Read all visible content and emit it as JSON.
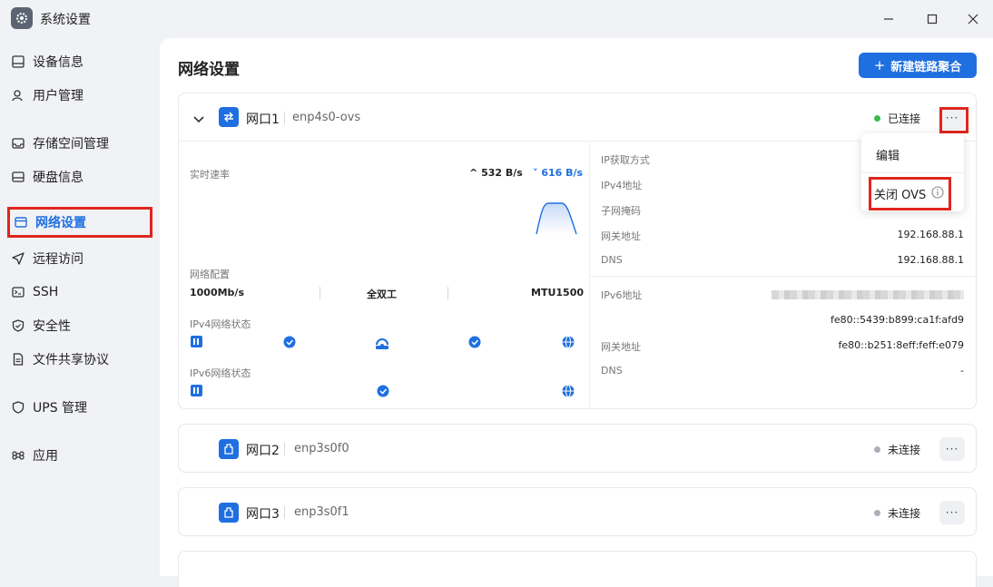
{
  "window": {
    "title": "系统设置"
  },
  "sidebar": {
    "items": [
      {
        "label": "设备信息",
        "icon": "device-icon"
      },
      {
        "label": "用户管理",
        "icon": "user-icon"
      },
      {
        "label": "存储空间管理",
        "icon": "storage-icon"
      },
      {
        "label": "硬盘信息",
        "icon": "disk-icon"
      },
      {
        "label": "网络设置",
        "icon": "network-icon",
        "active": true
      },
      {
        "label": "远程访问",
        "icon": "send-icon"
      },
      {
        "label": "SSH",
        "icon": "terminal-icon"
      },
      {
        "label": "安全性",
        "icon": "shield-icon"
      },
      {
        "label": "文件共享协议",
        "icon": "file-icon"
      },
      {
        "label": "UPS 管理",
        "icon": "ups-shield-icon"
      },
      {
        "label": "应用",
        "icon": "command-icon"
      }
    ]
  },
  "main": {
    "title": "网络设置",
    "new_button": "新建链路聚合",
    "ports": [
      {
        "name": "网口1",
        "device": "enp4s0-ovs",
        "status": "已连接",
        "status_color": "#3fb950",
        "left": {
          "speed_label": "实时速率",
          "up_speed": "532 B/s",
          "down_speed": "616 B/s",
          "config_label": "网络配置",
          "link_speed": "1000Mb/s",
          "duplex": "全双工",
          "mtu": "MTU1500",
          "ipv4_status_label": "IPv4网络状态",
          "ipv6_status_label": "IPv6网络状态"
        },
        "right": {
          "ip_method_label": "IP获取方式",
          "ipv4_label": "IPv4地址",
          "mask_label": "子网掩码",
          "gateway_label": "网关地址",
          "gateway": "192.168.88.1",
          "dns_label": "DNS",
          "dns": "192.168.88.1",
          "ipv6_label": "IPv6地址",
          "ipv6": "fe80::5439:b899:ca1f:afd9",
          "gateway6_label": "网关地址",
          "gateway6": "fe80::b251:8eff:feff:e079",
          "dns6_label": "DNS",
          "dns6": "-"
        }
      },
      {
        "name": "网口2",
        "device": "enp3s0f0",
        "status": "未连接",
        "status_color": "#aab0b8"
      },
      {
        "name": "网口3",
        "device": "enp3s0f1",
        "status": "未连接",
        "status_color": "#aab0b8"
      }
    ],
    "menu": {
      "edit": "编辑",
      "close_ovs": "关闭 OVS"
    }
  },
  "colors": {
    "accent": "#1f6fe0",
    "highlight": "#e0261d"
  }
}
